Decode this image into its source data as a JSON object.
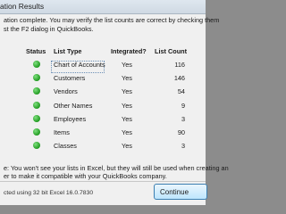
{
  "window": {
    "title": "ation Results"
  },
  "description": {
    "line1": "ation complete.  You may verify the list counts are correct by checking them",
    "line2": "st the F2 dialog in QuickBooks."
  },
  "table": {
    "headers": {
      "status": "Status",
      "type": "List Type",
      "integrated": "Integrated?",
      "count": "List Count"
    },
    "rows": [
      {
        "type": "Chart of Accounts",
        "integrated": "Yes",
        "count": "116"
      },
      {
        "type": "Customers",
        "integrated": "Yes",
        "count": "146"
      },
      {
        "type": "Vendors",
        "integrated": "Yes",
        "count": "54"
      },
      {
        "type": "Other Names",
        "integrated": "Yes",
        "count": "9"
      },
      {
        "type": "Employees",
        "integrated": "Yes",
        "count": "3"
      },
      {
        "type": "Items",
        "integrated": "Yes",
        "count": "90"
      },
      {
        "type": "Classes",
        "integrated": "Yes",
        "count": "3"
      }
    ],
    "status_color": "#22a022"
  },
  "footer": {
    "line1": "e:  You won't see your lists in Excel, but they will still be used when creating an",
    "line2": "er to make it compatible with your QuickBooks company."
  },
  "status_bar": {
    "text": "cted using 32 bit Excel 16.0.7830"
  },
  "buttons": {
    "continue": "Continue"
  }
}
